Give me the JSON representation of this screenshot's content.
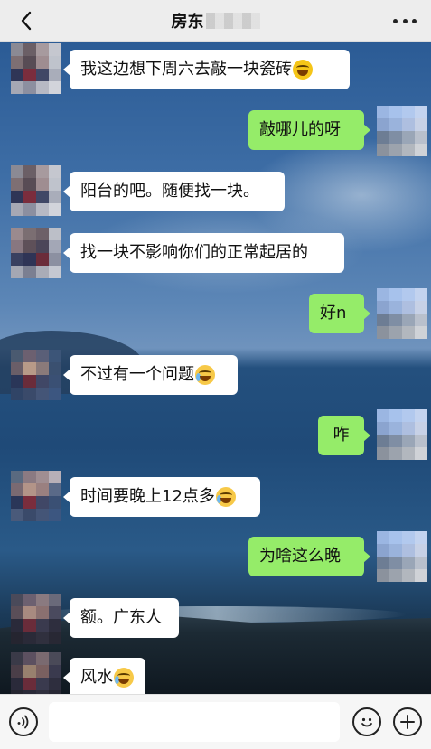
{
  "header": {
    "title": "房东"
  },
  "messages": [
    {
      "side": "left",
      "text": "我这边想下周六去敲一块瓷砖",
      "emoji": "laugh-cry"
    },
    {
      "side": "right",
      "text": "敲哪儿的呀"
    },
    {
      "side": "left",
      "text": "阳台的吧。随便找一块。"
    },
    {
      "side": "left",
      "text": "找一块不影响你们的正常起居的"
    },
    {
      "side": "right",
      "text": "好n"
    },
    {
      "side": "left",
      "text": "不过有一个问题",
      "emoji": "sweat-smile"
    },
    {
      "side": "right",
      "text": "咋"
    },
    {
      "side": "left",
      "text": "时间要晚上12点多",
      "emoji": "sweat-smile"
    },
    {
      "side": "right",
      "text": "为啥这么晚"
    },
    {
      "side": "left",
      "text": "额。广东人"
    },
    {
      "side": "left",
      "text": "风水",
      "emoji": "sweat-smile"
    }
  ],
  "composer": {
    "value": "",
    "icons": [
      "voice-icon",
      "emoji-icon",
      "plus-icon"
    ]
  },
  "colors": {
    "header_bg": "#ededed",
    "bubble_left": "#ffffff",
    "bubble_right": "#95ec69",
    "bottom_bg": "#f6f6f6"
  }
}
